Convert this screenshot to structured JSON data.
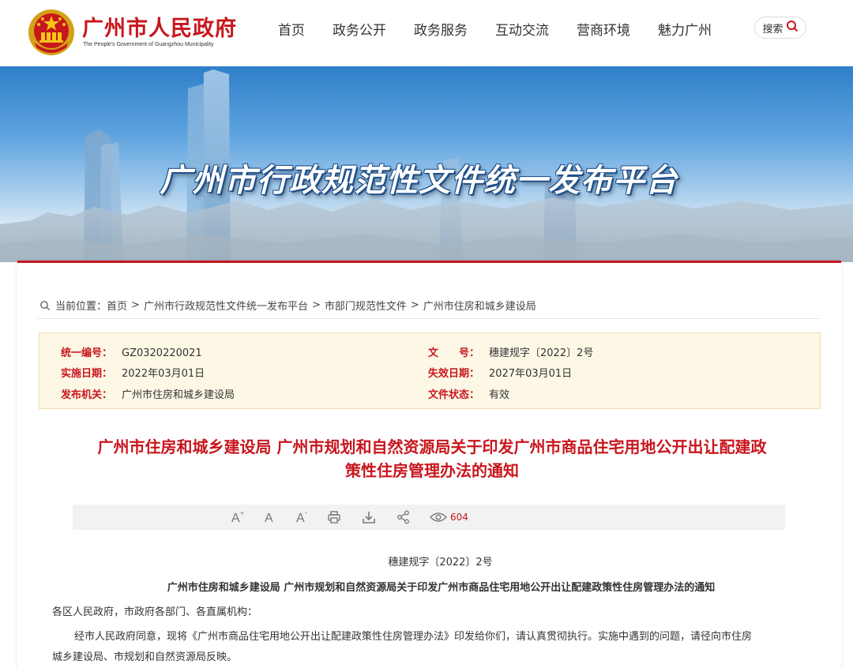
{
  "header": {
    "title": "广州市人民政府",
    "subtitle": "The People's Government of Guangzhou Municipality",
    "nav": [
      "首页",
      "政务公开",
      "政务服务",
      "互动交流",
      "营商环境",
      "魅力广州"
    ],
    "search_label": "搜索"
  },
  "banner": {
    "title": "广州市行政规范性文件统一发布平台"
  },
  "breadcrumb": {
    "prefix": "当前位置：",
    "items": [
      "首页",
      "广州市行政规范性文件统一发布平台",
      "市部门规范性文件",
      "广州市住房和城乡建设局"
    ],
    "separator": ">"
  },
  "meta": {
    "unified_no_key": "统一编号：",
    "unified_no": "GZ0320220021",
    "doc_no_key": "文　　号：",
    "doc_no": "穗建规字〔2022〕2号",
    "effective_key": "实施日期：",
    "effective": "2022年03月01日",
    "expire_key": "失效日期：",
    "expire": "2027年03月01日",
    "issuer_key": "发布机关：",
    "issuer": "广州市住房和城乡建设局",
    "status_key": "文件状态：",
    "status": "有效"
  },
  "doc": {
    "title_line1": "广州市住房和城乡建设局 广州市规划和自然资源局关于印发广州市商品住宅用地公开出让配建政",
    "title_line2": "策性住房管理办法的通知",
    "view_count": "604",
    "number": "穗建规字〔2022〕2号",
    "subtitle": "广州市住房和城乡建设局  广州市规划和自然资源局关于印发广州市商品住宅用地公开出让配建政策性住房管理办法的通知",
    "salutation": "各区人民政府，市政府各部门、各直属机构：",
    "body_line1": "经市人民政府同意，现将《广州市商品住宅用地公开出让配建政策性住房管理办法》印发给你们，请认真贯彻执行。实施中遇到的问题，请径向市住房",
    "body_line2": "城乡建设局、市规划和自然资源局反映。"
  },
  "colors": {
    "brand_red": "#c8161d",
    "meta_bg": "#fdf7e6",
    "toolbar_bg": "#f2f2f2"
  },
  "icons": [
    "emblem-icon",
    "search-icon",
    "location-icon",
    "font-increase-icon",
    "font-normal-icon",
    "font-decrease-icon",
    "print-icon",
    "download-icon",
    "share-icon",
    "eye-icon"
  ]
}
